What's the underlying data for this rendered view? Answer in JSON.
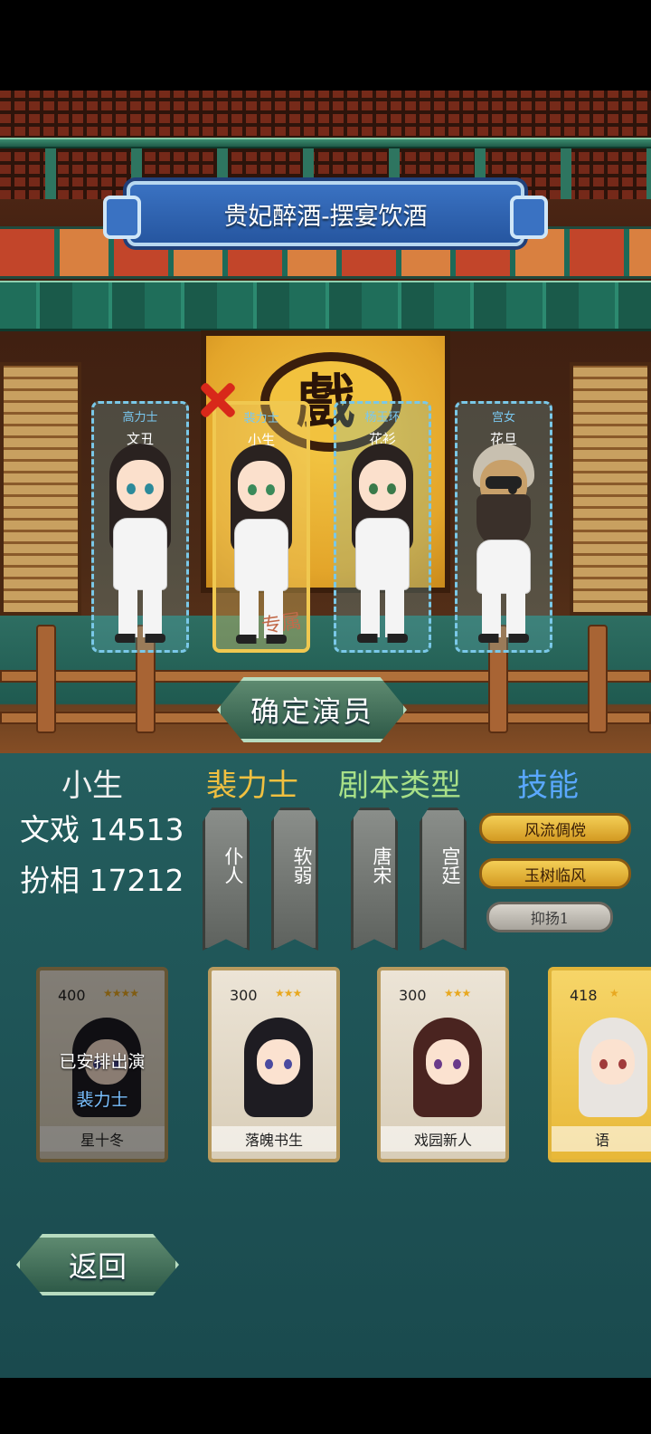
{
  "scene": {
    "title": "贵妃醉酒-摆宴饮酒",
    "stage_sign": "戲"
  },
  "slots": [
    {
      "character": "高力士",
      "role": "文丑",
      "selected": false
    },
    {
      "character": "裴力士",
      "role": "小生",
      "selected": true,
      "exclusive": "专属"
    },
    {
      "character": "杨玉环",
      "role": "花衫",
      "selected": false
    },
    {
      "character": "宫女",
      "role": "花旦",
      "selected": false
    }
  ],
  "confirm_label": "确定演员",
  "info": {
    "role": "小生",
    "actor": "裴力士",
    "script_type_label": "剧本类型",
    "skill_label": "技能",
    "stats": [
      {
        "label": "文戏",
        "value": "14513"
      },
      {
        "label": "扮相",
        "value": "17212"
      }
    ],
    "tags": [
      "仆人",
      "软弱",
      "唐宋",
      "宫廷"
    ],
    "skills": [
      "风流倜傥",
      "玉树临风",
      "抑扬1"
    ]
  },
  "cards": [
    {
      "name": "星十冬",
      "cost": "400",
      "stars": 4,
      "status": "已安排出演",
      "assigned_to": "裴力士",
      "exclusive": "专属"
    },
    {
      "name": "落魄书生",
      "cost": "300",
      "stars": 3
    },
    {
      "name": "戏园新人",
      "cost": "300",
      "stars": 3
    },
    {
      "name": "语",
      "cost": "418",
      "stars": 1
    }
  ],
  "back_label": "返回",
  "colors": {
    "accent_gold": "#f0c040",
    "accent_blue": "#5aa8ff",
    "accent_green": "#a8e088",
    "panel_teal": "#245e5e"
  }
}
